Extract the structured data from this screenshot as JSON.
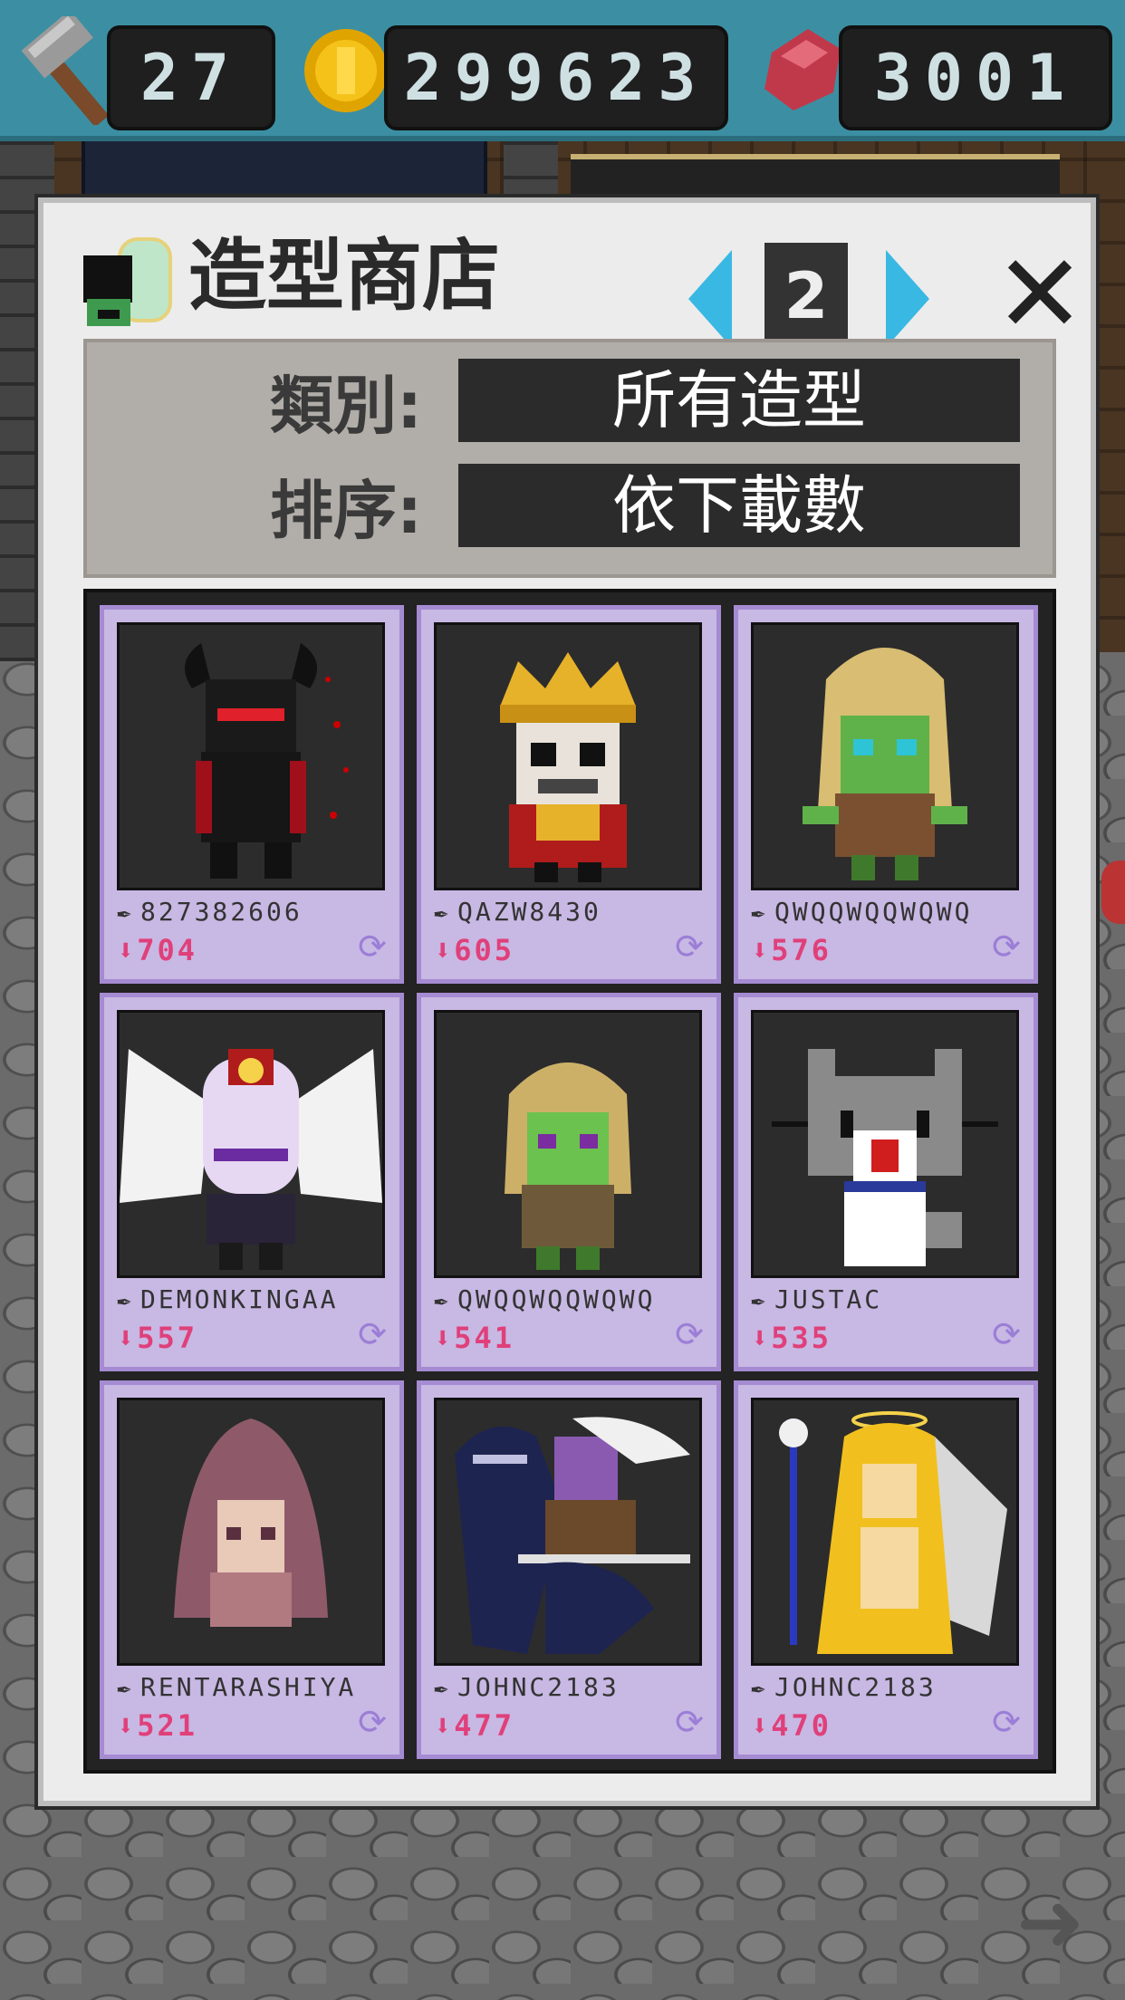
{
  "hud": {
    "hammers": "27",
    "coins": "299623",
    "gems": "3001",
    "hammer_icon": "hammer-icon",
    "coin_icon": "coin-icon",
    "gem_icon": "gem-icon"
  },
  "shop": {
    "title": "造型商店",
    "page": "2",
    "category_label": "類別:",
    "category_value": "所有造型",
    "sort_label": "排序:",
    "sort_value": "依下載數"
  },
  "skins": [
    {
      "author": "827382606",
      "downloads": "704"
    },
    {
      "author": "QAZW8430",
      "downloads": "605"
    },
    {
      "author": "QWQQWQQWQWQ",
      "downloads": "576"
    },
    {
      "author": "DEMONKINGAA",
      "downloads": "557"
    },
    {
      "author": "QWQQWQQWQWQ",
      "downloads": "541"
    },
    {
      "author": "JUSTAC",
      "downloads": "535"
    },
    {
      "author": "RENTARASHIYA",
      "downloads": "521"
    },
    {
      "author": "JOHNC2183",
      "downloads": "477"
    },
    {
      "author": "JOHNC2183",
      "downloads": "470"
    }
  ]
}
